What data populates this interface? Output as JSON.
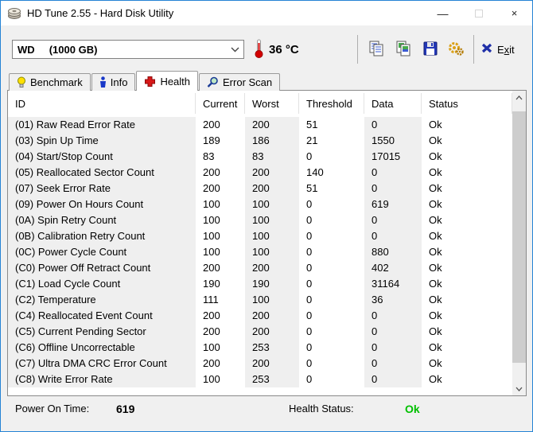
{
  "colors": {
    "window_accent": "#2583d5",
    "health_ok": "#00c000",
    "toolbar_bg": "#f0f0f0",
    "shaded_column": "#efefef"
  },
  "window": {
    "title": "HD Tune 2.55 - Hard Disk Utility",
    "controls": {
      "minimize": "—",
      "close": "×"
    }
  },
  "toolbar": {
    "drive_select_value": "WD     (1000 GB)",
    "temperature": "36 °C",
    "exit_prefix": "E",
    "exit_accel": "x",
    "exit_suffix": "it"
  },
  "icons": {
    "app-icon": "hard-disk",
    "thermometer-icon": "red thermometer",
    "copy-text-icon": "copy to clipboard",
    "copy-image-icon": "copy screenshot",
    "save-icon": "floppy disk",
    "options-icon": "gold gears",
    "exit-x-icon": "blue X",
    "combo-chevron-icon": "chevron-down",
    "scroll-up-icon": "chevron-up",
    "scroll-down-icon": "chevron-down"
  },
  "tabs": [
    {
      "label": "Benchmark",
      "icon": "lightbulb-icon",
      "active": false
    },
    {
      "label": "Info",
      "icon": "info-icon",
      "active": false
    },
    {
      "label": "Health",
      "icon": "health-cross-icon",
      "active": true
    },
    {
      "label": "Error Scan",
      "icon": "magnifier-icon",
      "active": false
    }
  ],
  "table": {
    "columns": [
      "ID",
      "Current",
      "Worst",
      "Threshold",
      "Data",
      "Status"
    ],
    "rows": [
      {
        "id": "(01) Raw Read Error Rate",
        "current": "200",
        "worst": "200",
        "threshold": "51",
        "data": "0",
        "status": "Ok"
      },
      {
        "id": "(03) Spin Up Time",
        "current": "189",
        "worst": "186",
        "threshold": "21",
        "data": "1550",
        "status": "Ok"
      },
      {
        "id": "(04) Start/Stop Count",
        "current": "83",
        "worst": "83",
        "threshold": "0",
        "data": "17015",
        "status": "Ok"
      },
      {
        "id": "(05) Reallocated Sector Count",
        "current": "200",
        "worst": "200",
        "threshold": "140",
        "data": "0",
        "status": "Ok"
      },
      {
        "id": "(07) Seek Error Rate",
        "current": "200",
        "worst": "200",
        "threshold": "51",
        "data": "0",
        "status": "Ok"
      },
      {
        "id": "(09) Power On Hours Count",
        "current": "100",
        "worst": "100",
        "threshold": "0",
        "data": "619",
        "status": "Ok"
      },
      {
        "id": "(0A) Spin Retry Count",
        "current": "100",
        "worst": "100",
        "threshold": "0",
        "data": "0",
        "status": "Ok"
      },
      {
        "id": "(0B) Calibration Retry Count",
        "current": "100",
        "worst": "100",
        "threshold": "0",
        "data": "0",
        "status": "Ok"
      },
      {
        "id": "(0C) Power Cycle Count",
        "current": "100",
        "worst": "100",
        "threshold": "0",
        "data": "880",
        "status": "Ok"
      },
      {
        "id": "(C0) Power Off Retract Count",
        "current": "200",
        "worst": "200",
        "threshold": "0",
        "data": "402",
        "status": "Ok"
      },
      {
        "id": "(C1) Load Cycle Count",
        "current": "190",
        "worst": "190",
        "threshold": "0",
        "data": "31164",
        "status": "Ok"
      },
      {
        "id": "(C2) Temperature",
        "current": "111",
        "worst": "100",
        "threshold": "0",
        "data": "36",
        "status": "Ok"
      },
      {
        "id": "(C4) Reallocated Event Count",
        "current": "200",
        "worst": "200",
        "threshold": "0",
        "data": "0",
        "status": "Ok"
      },
      {
        "id": "(C5) Current Pending Sector",
        "current": "200",
        "worst": "200",
        "threshold": "0",
        "data": "0",
        "status": "Ok"
      },
      {
        "id": "(C6) Offline Uncorrectable",
        "current": "100",
        "worst": "253",
        "threshold": "0",
        "data": "0",
        "status": "Ok"
      },
      {
        "id": "(C7) Ultra DMA CRC Error Count",
        "current": "200",
        "worst": "200",
        "threshold": "0",
        "data": "0",
        "status": "Ok"
      },
      {
        "id": "(C8) Write Error Rate",
        "current": "100",
        "worst": "253",
        "threshold": "0",
        "data": "0",
        "status": "Ok"
      }
    ]
  },
  "statusbar": {
    "power_on_label": "Power On Time:",
    "power_on_value": "619",
    "health_label": "Health Status:",
    "health_value": "Ok",
    "health_color": "#00c000"
  }
}
